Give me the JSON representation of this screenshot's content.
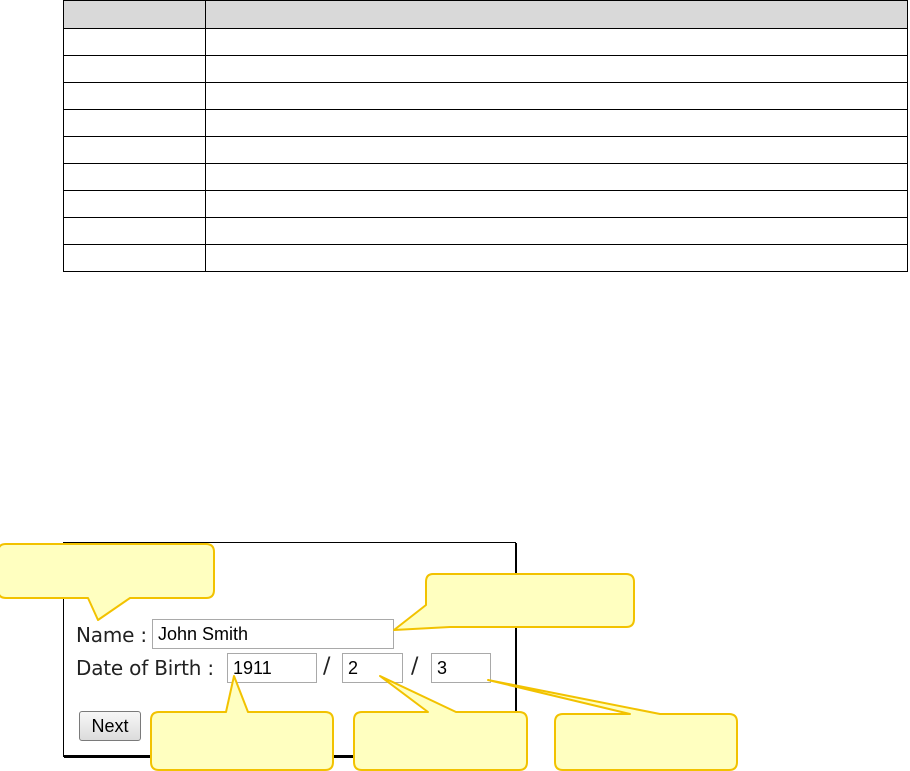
{
  "table": {
    "headers": [
      "",
      ""
    ],
    "rows": [
      [
        "",
        ""
      ],
      [
        "",
        ""
      ],
      [
        "",
        ""
      ],
      [
        "",
        ""
      ],
      [
        "",
        ""
      ],
      [
        "",
        ""
      ],
      [
        "",
        ""
      ],
      [
        "",
        ""
      ],
      [
        "",
        ""
      ]
    ]
  },
  "form": {
    "name_label": "Name :",
    "name_value": "John Smith",
    "dob_label": "Date of Birth :",
    "dob_year": "1911",
    "dob_month": "2",
    "dob_day": "3",
    "separator": "/",
    "next_label": "Next"
  },
  "callouts": {
    "fill_color": "#ffffc0",
    "border_color": "#f2c200",
    "texts": [
      "",
      "",
      "",
      "",
      ""
    ]
  }
}
